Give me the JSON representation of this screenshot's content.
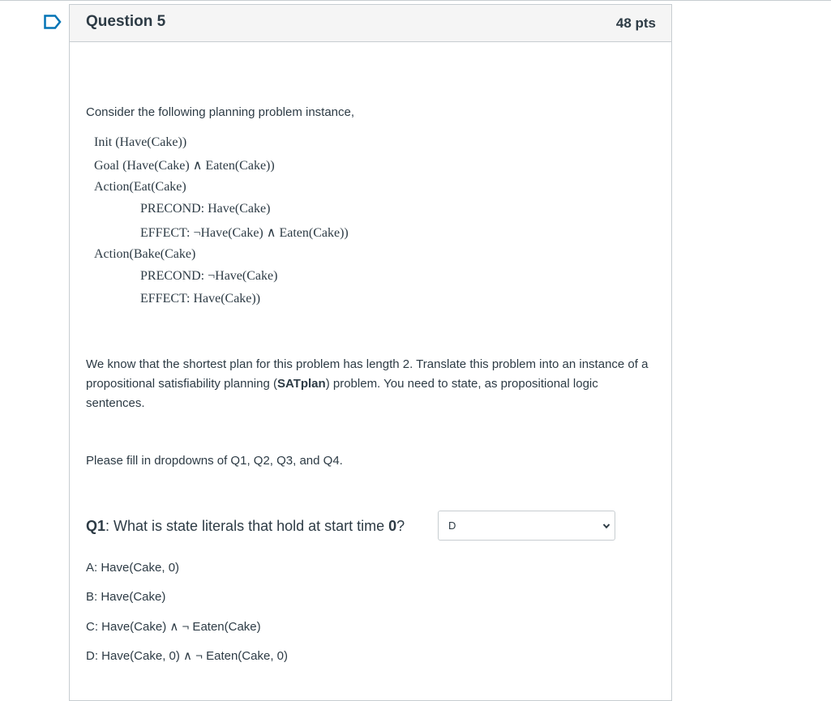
{
  "question": {
    "title": "Question 5",
    "points": "48 pts",
    "intro": "Consider the following planning problem instance,",
    "planning": {
      "init": "Init (Have(Cake))",
      "goal": "Goal (Have(Cake) ∧ Eaten(Cake))",
      "action1": "Action(Eat(Cake)",
      "action1_precond": "PRECOND: Have(Cake)",
      "action1_effect": "EFFECT: ¬Have(Cake) ∧ Eaten(Cake))",
      "action2": "Action(Bake(Cake)",
      "action2_precond": "PRECOND: ¬Have(Cake)",
      "action2_effect": "EFFECT: Have(Cake))"
    },
    "para_part1": "We know that the shortest plan for this problem has length 2. Translate this problem into an instance of a propositional satisfiability planning (",
    "para_bold": "SATplan",
    "para_part2": ") problem. You need to state, as propositional logic sentences.",
    "fill_instruction": "Please fill in dropdowns of Q1, Q2, Q3, and Q4.",
    "q1_label": "Q1",
    "q1_text": ": What is state literals that hold at start time ",
    "q1_time": "0",
    "q1_end": "?",
    "q1_dropdown_value": "D",
    "options": [
      "A: Have(Cake, 0)",
      "B: Have(Cake)",
      "C: Have(Cake) ∧ ¬ Eaten(Cake)",
      "D: Have(Cake, 0) ∧ ¬ Eaten(Cake, 0)"
    ]
  },
  "icons": {
    "flag": "bookmark-flag-icon",
    "dropdown": "chevron-down-icon"
  },
  "colors": {
    "text": "#2d3b45",
    "border": "#c7cdd1",
    "header_bg": "#f5f5f5",
    "flag": "#0374b5"
  }
}
